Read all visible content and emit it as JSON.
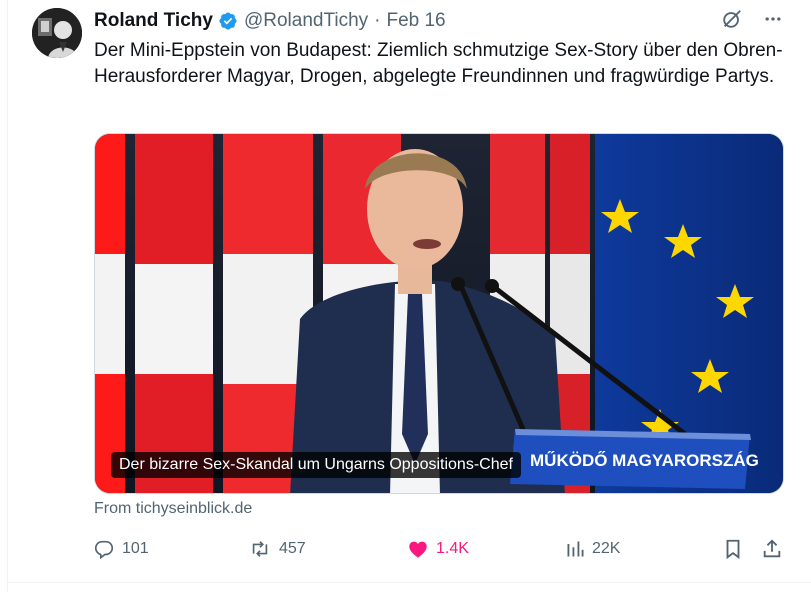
{
  "tweet": {
    "author": "Roland Tichy",
    "handle": "@RolandTichy",
    "separator": "·",
    "date": "Feb 16",
    "text": "Der Mini-Eppstein von Budapest: Ziemlich schmutzige Sex-Story über den Obren-Herausforderer Magyar, Drogen, abgelegte Freundinnen und fragwürdige Partys.",
    "card": {
      "caption": "Der bizarre Sex-Skandal um Ungarns Oppositions-Chef",
      "podium_text": "MŰKÖDŐ MAGYARORSZÁG",
      "source": "From tichyseinblick.de"
    }
  },
  "metrics": {
    "replies": "101",
    "reposts": "457",
    "likes": "1.4K",
    "views": "22K"
  },
  "icons": {
    "verified": "verified-badge-icon",
    "grok": "grok-icon",
    "more": "more-icon",
    "reply": "reply-icon",
    "repost": "repost-icon",
    "like": "heart-icon",
    "views": "views-icon",
    "bookmark": "bookmark-icon",
    "share": "share-icon"
  },
  "colors": {
    "like_active": "#f91880",
    "verified": "#1d9bf0",
    "muted": "#536471"
  }
}
